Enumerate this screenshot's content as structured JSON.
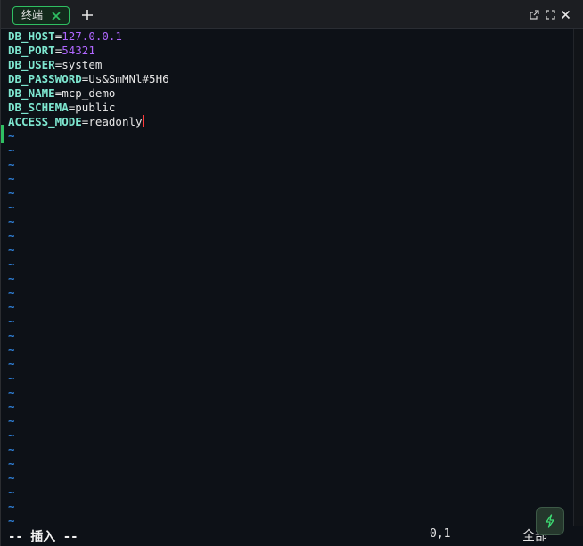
{
  "tabbar": {
    "tab_label": "终端"
  },
  "editor": {
    "lines": [
      {
        "key": "DB_HOST",
        "eq": "=",
        "value": "127.0.0.1",
        "value_kind": "num"
      },
      {
        "key": "DB_PORT",
        "eq": "=",
        "value": "54321",
        "value_kind": "num"
      },
      {
        "key": "DB_USER",
        "eq": "=",
        "value": "system",
        "value_kind": "val"
      },
      {
        "key": "DB_PASSWORD",
        "eq": "=",
        "value": "Us&SmMNl#5H6",
        "value_kind": "val"
      },
      {
        "key": "DB_NAME",
        "eq": "=",
        "value": "mcp_demo",
        "value_kind": "val"
      },
      {
        "key": "DB_SCHEMA",
        "eq": "=",
        "value": "public",
        "value_kind": "val"
      },
      {
        "key": "ACCESS_MODE",
        "eq": "=",
        "value": "readonly",
        "value_kind": "val"
      }
    ],
    "empty_line_marker": "~",
    "empty_line_count": 28
  },
  "statusline": {
    "mode": "-- 插入 --",
    "cursor_position": "0,1",
    "scope": "全部"
  },
  "colors": {
    "key": "#7ee7d0",
    "number": "#b067ff",
    "tilde": "#2f7fd6",
    "tab_accent": "#2fbf62",
    "cursor": "#ff3b3b"
  },
  "icons": {
    "tab_close": "close-icon",
    "add_tab": "plus-icon",
    "popout": "external-link-icon",
    "maximize": "maximize-icon",
    "close_window": "close-icon",
    "fab": "lightning-icon"
  }
}
